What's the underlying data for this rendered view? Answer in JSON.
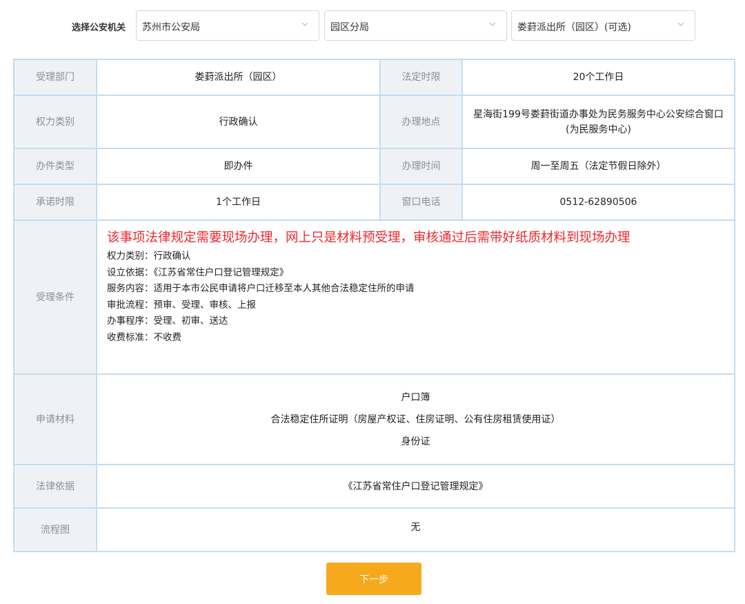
{
  "selector": {
    "label": "选择公安机关",
    "city": "苏州市公安局",
    "branch": "园区分局",
    "station": "娄葑派出所（园区）(可选)"
  },
  "details": {
    "dept_label": "受理部门",
    "dept_value": "娄葑派出所（园区）",
    "legal_limit_label": "法定时限",
    "legal_limit_value": "20个工作日",
    "power_label": "权力类别",
    "power_value": "行政确认",
    "location_label": "办理地点",
    "location_value": "星海街199号娄葑街道办事处为民务服务中心公安综合窗口(为民服务中心)",
    "type_label": "办件类型",
    "type_value": "即办件",
    "hours_label": "办理时间",
    "hours_value": "周一至周五（法定节假日除外）",
    "promise_label": "承诺时限",
    "promise_value": "1个工作日",
    "phone_label": "窗口电话",
    "phone_value": "0512-62890506"
  },
  "conditions": {
    "label": "受理条件",
    "notice": "该事项法律规定需要现场办理，网上只是材料预受理，审核通过后需带好纸质材料到现场办理",
    "lines": [
      "权力类别：行政确认",
      "设立依据：《江苏省常住户口登记管理规定》",
      "服务内容：适用于本市公民申请将户口迁移至本人其他合法稳定住所的申请",
      "审批流程：预审、受理、审核、上报",
      "办事程序：受理、初审、送达",
      "收费标准：不收费"
    ]
  },
  "materials": {
    "label": "申请材料",
    "items": [
      "户口簿",
      "合法稳定住所证明（房屋产权证、住房证明、公有住房租赁使用证）",
      "身份证"
    ]
  },
  "legal_basis": {
    "label": "法律依据",
    "value": "《江苏省常住户口登记管理规定》"
  },
  "flowchart": {
    "label": "流程图",
    "value": "无"
  },
  "next_button": "下一步",
  "colors": {
    "accent": "#f7a91c",
    "notice": "#f0272b",
    "border": "#c5dcef",
    "label_bg": "#eef2f7"
  },
  "icons": {
    "dropdown": "chevron-down-icon"
  }
}
